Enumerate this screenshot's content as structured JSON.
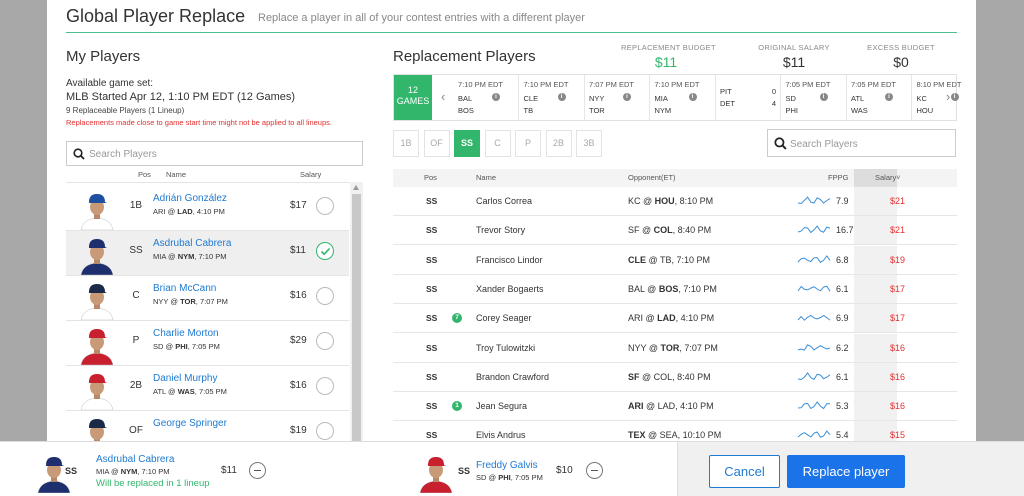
{
  "header": {
    "title": "Global Player Replace",
    "subtitle": "Replace a player in all of your contest entries with a different player"
  },
  "my_players": {
    "title": "My Players",
    "game_set_label": "Available game set:",
    "game_set_value": "MLB Started Apr 12, 1:10 PM EDT (12 Games)",
    "replaceable": "9 Replaceable Players (1 Lineup)",
    "warning": "Replacements made close to game start time might not be applied to all lineups.",
    "search_placeholder": "Search Players",
    "columns": {
      "pos": "Pos",
      "name": "Name",
      "salary": "Salary"
    },
    "players": [
      {
        "pos": "1B",
        "name": "Adrián González",
        "game": [
          "ARI @ ",
          "LAD",
          ", 4:10 PM"
        ],
        "salary": "$17",
        "selected": false,
        "jersey": "#ffffff",
        "cap": "#1e4fa0"
      },
      {
        "pos": "SS",
        "name": "Asdrubal Cabrera",
        "game": [
          "MIA @ ",
          "NYM",
          ", 7:10 PM"
        ],
        "salary": "$11",
        "selected": true,
        "jersey": "#1d2f6e",
        "cap": "#1d2f6e"
      },
      {
        "pos": "C",
        "name": "Brian McCann",
        "game": [
          "NYY @ ",
          "TOR",
          ", 7:07 PM"
        ],
        "salary": "$16",
        "selected": false,
        "jersey": "#ffffff",
        "cap": "#1c2a4a"
      },
      {
        "pos": "P",
        "name": "Charlie Morton",
        "game": [
          "SD @ ",
          "PHI",
          ", 7:05 PM"
        ],
        "salary": "$29",
        "selected": false,
        "jersey": "#c8202f",
        "cap": "#c8202f"
      },
      {
        "pos": "2B",
        "name": "Daniel Murphy",
        "game": [
          "ATL @ ",
          "WAS",
          ", 7:05 PM"
        ],
        "salary": "$16",
        "selected": false,
        "jersey": "#ffffff",
        "cap": "#c8202f"
      },
      {
        "pos": "OF",
        "name": "George Springer",
        "game": [
          "",
          "",
          ""
        ],
        "salary": "$19",
        "selected": false,
        "jersey": "#e8e8e8",
        "cap": "#1c2a4a"
      }
    ]
  },
  "budget": {
    "replacement_label": "REPLACEMENT BUDGET",
    "replacement_value": "$11",
    "original_label": "ORIGINAL SALARY",
    "original_value": "$11",
    "excess_label": "EXCESS BUDGET",
    "excess_value": "$0"
  },
  "replacement": {
    "title": "Replacement Players",
    "games_all_line1": "12",
    "games_all_line2": "GAMES",
    "games": [
      {
        "time": "7:10 PM EDT",
        "away": "BAL",
        "home": "BOS"
      },
      {
        "time": "7:10 PM EDT",
        "away": "CLE",
        "home": "TB"
      },
      {
        "time": "7:07 PM EDT",
        "away": "NYY",
        "home": "TOR"
      },
      {
        "time": "7:10 PM EDT",
        "away": "MIA",
        "home": "NYM"
      },
      {
        "time": "",
        "away": "PIT",
        "home": "DET",
        "away_score": "0",
        "home_score": "4",
        "live": true
      },
      {
        "time": "7:05 PM EDT",
        "away": "SD",
        "home": "PHI"
      },
      {
        "time": "7:05 PM EDT",
        "away": "ATL",
        "home": "WAS"
      },
      {
        "time": "8:10 PM EDT",
        "away": "KC",
        "home": "HOU"
      }
    ],
    "info_icon": "i",
    "position_tabs": [
      "1B",
      "OF",
      "SS",
      "C",
      "P",
      "2B",
      "3B"
    ],
    "active_tab": "SS",
    "search_placeholder": "Search Players",
    "columns": {
      "pos": "Pos",
      "name": "Name",
      "opponent": "Opponent(ET)",
      "fppg": "FPPG",
      "salary": "Salary"
    },
    "players": [
      {
        "pos": "SS",
        "badge": "",
        "name": "Carlos Correa",
        "opp": [
          "KC @ ",
          "HOU",
          ", 8:10 PM"
        ],
        "bold_home": true,
        "fppg": "7.9",
        "salary": "$21"
      },
      {
        "pos": "SS",
        "badge": "",
        "name": "Trevor Story",
        "opp": [
          "SF @ ",
          "COL",
          ", 8:40 PM"
        ],
        "bold_home": true,
        "fppg": "16.7",
        "salary": "$21"
      },
      {
        "pos": "SS",
        "badge": "",
        "name": "Francisco Lindor",
        "opp": [
          "CLE",
          " @ TB, 7:10 PM",
          ""
        ],
        "bold_home": false,
        "fppg": "6.8",
        "salary": "$19"
      },
      {
        "pos": "SS",
        "badge": "",
        "name": "Xander Bogaerts",
        "opp": [
          "BAL @ ",
          "BOS",
          ", 7:10 PM"
        ],
        "bold_home": true,
        "fppg": "6.1",
        "salary": "$17"
      },
      {
        "pos": "SS",
        "badge": "7",
        "name": "Corey Seager",
        "opp": [
          "ARI @ ",
          "LAD",
          ", 4:10 PM"
        ],
        "bold_home": true,
        "fppg": "6.9",
        "salary": "$17"
      },
      {
        "pos": "SS",
        "badge": "",
        "name": "Troy Tulowitzki",
        "opp": [
          "NYY @ ",
          "TOR",
          ", 7:07 PM"
        ],
        "bold_home": true,
        "fppg": "6.2",
        "salary": "$16"
      },
      {
        "pos": "SS",
        "badge": "",
        "name": "Brandon Crawford",
        "opp": [
          "SF",
          " @ COL, 8:40 PM",
          ""
        ],
        "bold_home": false,
        "fppg": "6.1",
        "salary": "$16"
      },
      {
        "pos": "SS",
        "badge": "1",
        "name": "Jean Segura",
        "opp": [
          "ARI",
          " @ LAD, 4:10 PM",
          ""
        ],
        "bold_home": false,
        "fppg": "5.3",
        "salary": "$16"
      },
      {
        "pos": "SS",
        "badge": "",
        "name": "Elvis Andrus",
        "opp": [
          "TEX",
          " @ SEA, 10:10 PM",
          ""
        ],
        "bold_home": false,
        "fppg": "5.4",
        "salary": "$15"
      }
    ]
  },
  "footer": {
    "out_pos": "SS",
    "out_name": "Asdrubal Cabrera",
    "out_game": [
      "MIA @ ",
      "NYM",
      ", 7:10 PM"
    ],
    "out_salary": "$11",
    "out_note": "Will be replaced in 1 lineup",
    "in_pos": "SS",
    "in_name": "Freddy Galvis",
    "in_game": [
      "SD @ ",
      "PHI",
      ", 7:05 PM"
    ],
    "in_salary": "$10",
    "cancel_label": "Cancel",
    "replace_label": "Replace player"
  },
  "colors": {
    "accent_green": "#31b66c",
    "link_blue": "#1f7ad1",
    "salary_red": "#e4302f",
    "primary_button": "#1a73e8"
  }
}
